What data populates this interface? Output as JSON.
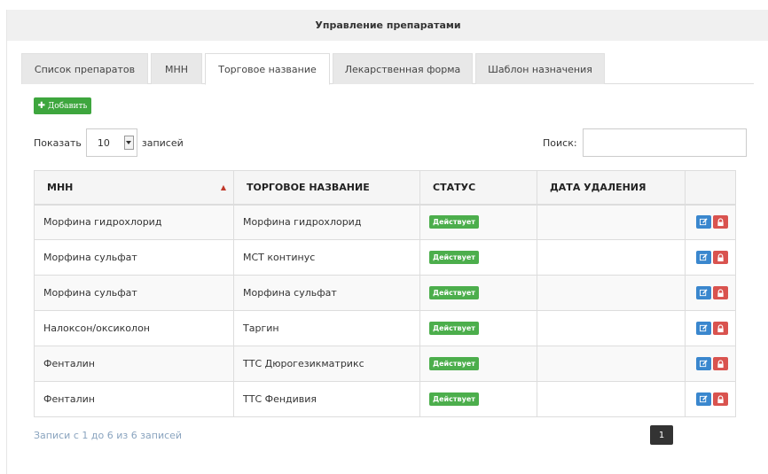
{
  "header": {
    "title": "Управление препаратами"
  },
  "tabs": [
    {
      "label": "Список препаратов"
    },
    {
      "label": "МНН"
    },
    {
      "label": "Торговое название"
    },
    {
      "label": "Лекарственная форма"
    },
    {
      "label": "Шаблон назначения"
    }
  ],
  "active_tab": "Торговое название",
  "add_button": {
    "label": "Добавить",
    "icon": "plus-icon"
  },
  "length": {
    "before": "Показать",
    "value": "10",
    "after": "записей"
  },
  "search": {
    "label": "Поиск:",
    "value": ""
  },
  "table": {
    "headers": [
      "МНН",
      "ТОРГОВОЕ НАЗВАНИЕ",
      "СТАТУС",
      "ДАТА УДАЛЕНИЯ",
      ""
    ],
    "sorted_column": "МНН",
    "sort_direction": "ascending",
    "rows": [
      {
        "mnn": "Морфина гидрохлорид",
        "trade": "Морфина гидрохлорид",
        "status": "Действует",
        "deleted": ""
      },
      {
        "mnn": "Морфина сульфат",
        "trade": "МСТ континус",
        "status": "Действует",
        "deleted": ""
      },
      {
        "mnn": "Морфина сульфат",
        "trade": "Морфина сульфат",
        "status": "Действует",
        "deleted": ""
      },
      {
        "mnn": "Налоксон/оксиколон",
        "trade": "Таргин",
        "status": "Действует",
        "deleted": ""
      },
      {
        "mnn": "Фенталин",
        "trade": "ТТС Дюрогезикматрикс",
        "status": "Действует",
        "deleted": ""
      },
      {
        "mnn": "Фенталин",
        "trade": "ТТС Фендивия",
        "status": "Действует",
        "deleted": ""
      }
    ],
    "row_actions": [
      "edit-icon",
      "lock-icon"
    ]
  },
  "info": "Записи с 1 до 6 из 6 записей",
  "pagination": {
    "current": "1"
  },
  "colors": {
    "add_button": "#3ea63e",
    "status_badge": "#4cae4c",
    "edit_button": "#3a87ce",
    "lock_button": "#d9534f",
    "info_text": "#8aa4bf",
    "page_button": "#333333"
  }
}
